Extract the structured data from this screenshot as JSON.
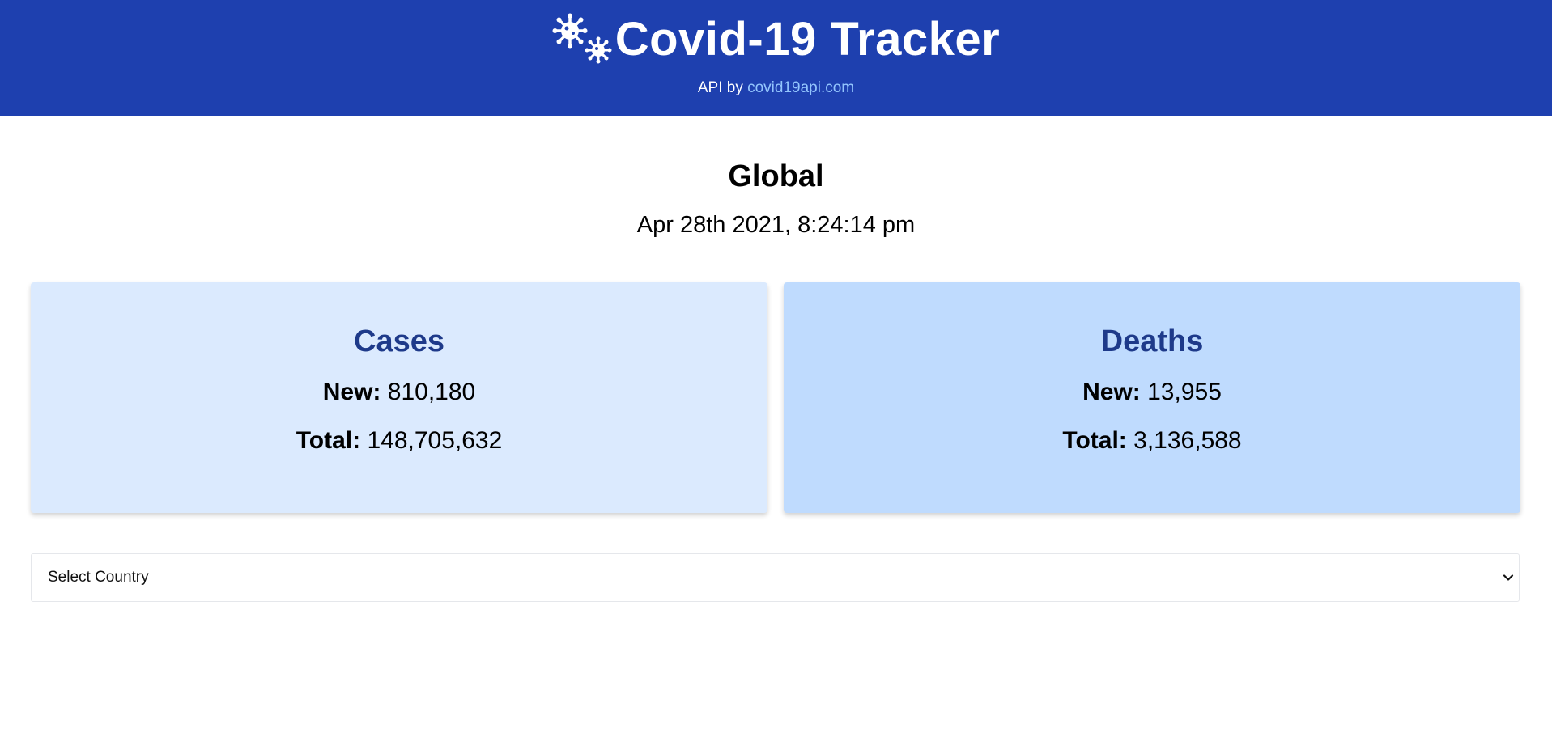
{
  "header": {
    "logo_icon": "virus-icon",
    "title": "Covid-19 Tracker",
    "api_prefix": "API by",
    "api_link_text": "covid19api.com",
    "background_color": "#1e40af",
    "link_color": "#93c5fd"
  },
  "region": {
    "title": "Global",
    "date": "Apr 28th 2021, 8:24:14 pm"
  },
  "cards": {
    "cases": {
      "title": "Cases",
      "new_label": "New:",
      "new_value": "810,180",
      "total_label": "Total:",
      "total_value": "148,705,632",
      "background_color": "#dbeafe"
    },
    "deaths": {
      "title": "Deaths",
      "new_label": "New:",
      "new_value": "13,955",
      "total_label": "Total:",
      "total_value": "3,136,588",
      "background_color": "#bfdbfe"
    }
  },
  "country_select": {
    "selected_label": "Select Country",
    "icon": "chevron-down-icon"
  }
}
